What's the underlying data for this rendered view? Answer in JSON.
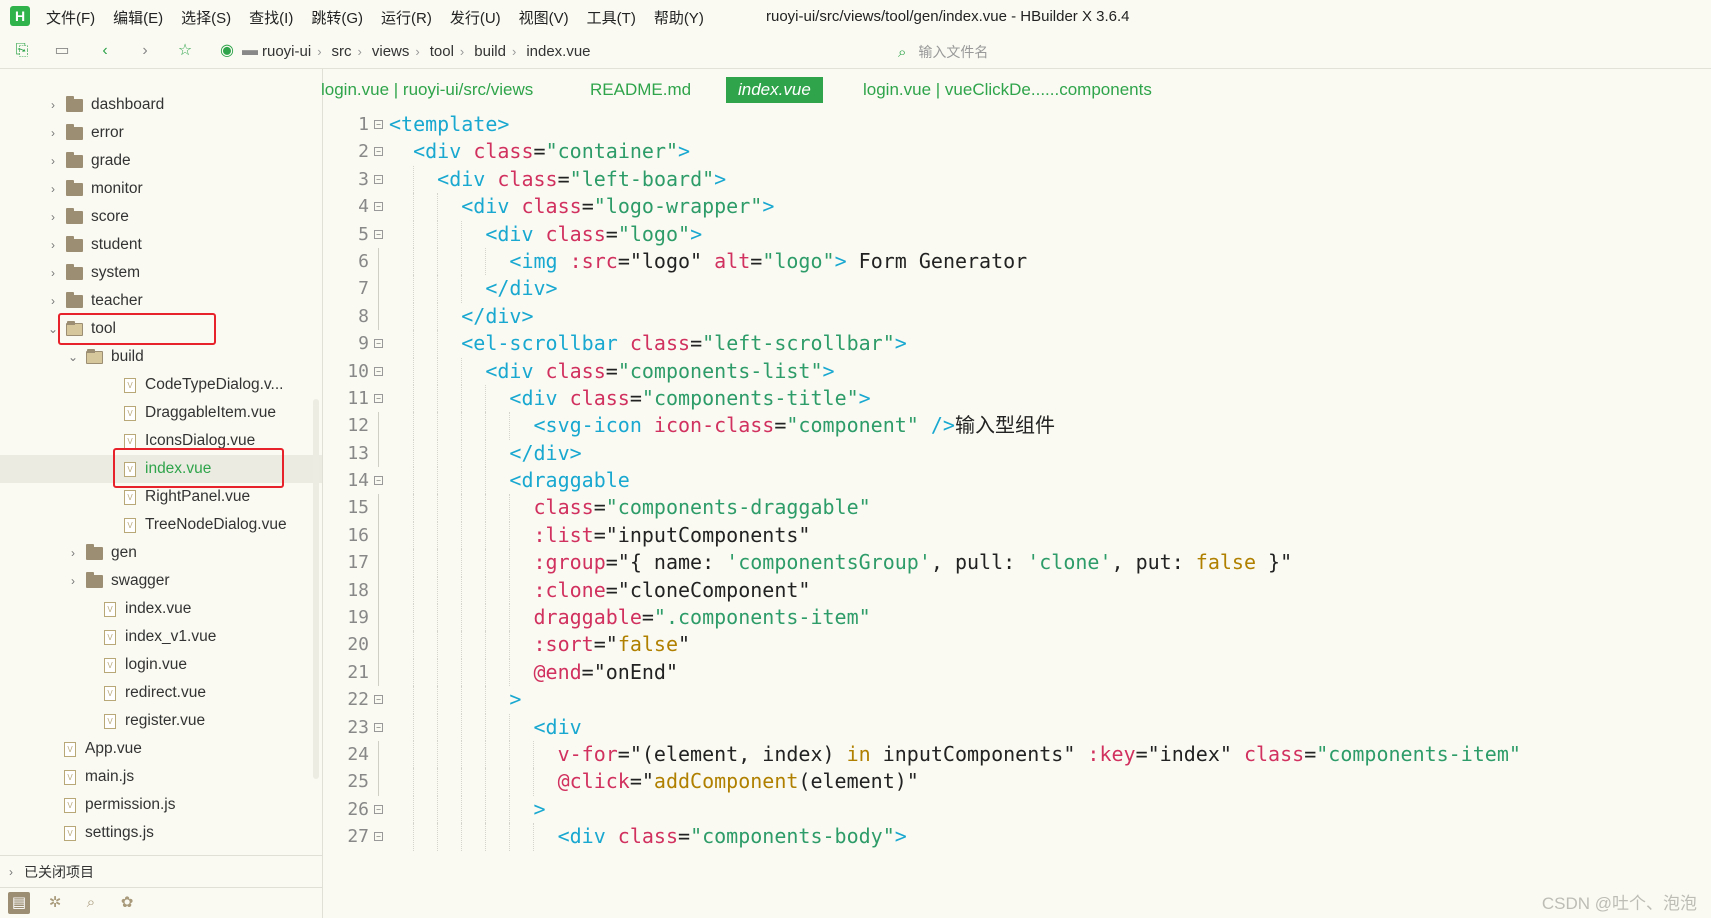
{
  "app": {
    "logo_text": "H",
    "menus": [
      "文件(F)",
      "编辑(E)",
      "选择(S)",
      "查找(I)",
      "跳转(G)",
      "运行(R)",
      "发行(U)",
      "视图(V)",
      "工具(T)",
      "帮助(Y)"
    ],
    "window_title": "ruoyi-ui/src/views/tool/gen/index.vue - HBuilder X 3.6.4"
  },
  "toolbar": {
    "icons": [
      "new-file-icon",
      "save-icon",
      "back-arrow-icon",
      "forward-arrow-icon",
      "star-icon",
      "run-icon"
    ],
    "breadcrumb": [
      "ruoyi-ui",
      "src",
      "views",
      "tool",
      "build",
      "index.vue"
    ],
    "file_search_placeholder": "输入文件名"
  },
  "sidebar": {
    "tree": [
      {
        "label": "dashboard",
        "kind": "folder",
        "depth": 0,
        "state": "collapsed"
      },
      {
        "label": "error",
        "kind": "folder",
        "depth": 0,
        "state": "collapsed"
      },
      {
        "label": "grade",
        "kind": "folder",
        "depth": 0,
        "state": "collapsed"
      },
      {
        "label": "monitor",
        "kind": "folder",
        "depth": 0,
        "state": "collapsed"
      },
      {
        "label": "score",
        "kind": "folder",
        "depth": 0,
        "state": "collapsed"
      },
      {
        "label": "student",
        "kind": "folder",
        "depth": 0,
        "state": "collapsed"
      },
      {
        "label": "system",
        "kind": "folder",
        "depth": 0,
        "state": "collapsed"
      },
      {
        "label": "teacher",
        "kind": "folder",
        "depth": 0,
        "state": "collapsed"
      },
      {
        "label": "tool",
        "kind": "folder",
        "depth": 0,
        "state": "expanded",
        "highlighted": true
      },
      {
        "label": "build",
        "kind": "folder",
        "depth": 1,
        "state": "expanded"
      },
      {
        "label": "CodeTypeDialog.v...",
        "kind": "file",
        "depth": 2
      },
      {
        "label": "DraggableItem.vue",
        "kind": "file",
        "depth": 2
      },
      {
        "label": "IconsDialog.vue",
        "kind": "file",
        "depth": 2
      },
      {
        "label": "index.vue",
        "kind": "file",
        "depth": 2,
        "selected": true,
        "highlighted": true
      },
      {
        "label": "RightPanel.vue",
        "kind": "file",
        "depth": 2
      },
      {
        "label": "TreeNodeDialog.vue",
        "kind": "file",
        "depth": 2
      },
      {
        "label": "gen",
        "kind": "folder",
        "depth": 1,
        "state": "collapsed"
      },
      {
        "label": "swagger",
        "kind": "folder",
        "depth": 1,
        "state": "collapsed"
      },
      {
        "label": "index.vue",
        "kind": "file",
        "depth": 1
      },
      {
        "label": "index_v1.vue",
        "kind": "file",
        "depth": 1
      },
      {
        "label": "login.vue",
        "kind": "file",
        "depth": 1
      },
      {
        "label": "redirect.vue",
        "kind": "file",
        "depth": 1
      },
      {
        "label": "register.vue",
        "kind": "file",
        "depth": 1
      },
      {
        "label": "App.vue",
        "kind": "file",
        "depth": -1
      },
      {
        "label": "main.js",
        "kind": "file",
        "depth": -1
      },
      {
        "label": "permission.js",
        "kind": "file",
        "depth": -1
      },
      {
        "label": "settings.js",
        "kind": "file",
        "depth": -1
      }
    ],
    "closed_projects_label": "已关闭项目",
    "bottom_icons": [
      "project-icon",
      "bug-icon",
      "search-code-icon",
      "plugin-icon"
    ]
  },
  "tabs": [
    {
      "label": "login.vue | ruoyi-ui/src/views",
      "active": false
    },
    {
      "label": "README.md",
      "active": false
    },
    {
      "label": "index.vue",
      "active": true
    },
    {
      "label": "login.vue | vueClickDe......components",
      "active": false
    }
  ],
  "code": {
    "line_numbers": [
      "1",
      "2",
      "3",
      "4",
      "5",
      "6",
      "7",
      "8",
      "9",
      "10",
      "11",
      "12",
      "13",
      "14",
      "15",
      "16",
      "17",
      "18",
      "19",
      "20",
      "21",
      "22",
      "23",
      "24",
      "25",
      "26",
      "27"
    ],
    "folds": [
      true,
      true,
      true,
      true,
      true,
      false,
      false,
      false,
      true,
      true,
      true,
      false,
      false,
      true,
      false,
      false,
      false,
      false,
      false,
      false,
      false,
      true,
      true,
      false,
      false,
      true,
      true
    ],
    "lines": [
      [
        [
          "t",
          "<template>"
        ]
      ],
      [
        [
          "p",
          "  "
        ],
        [
          "t",
          "<div"
        ],
        [
          "p",
          " "
        ],
        [
          "a",
          "class"
        ],
        [
          "p",
          "="
        ],
        [
          "s",
          "\"container\""
        ],
        [
          "t",
          ">"
        ]
      ],
      [
        [
          "p",
          "    "
        ],
        [
          "t",
          "<div"
        ],
        [
          "p",
          " "
        ],
        [
          "a",
          "class"
        ],
        [
          "p",
          "="
        ],
        [
          "s",
          "\"left-board\""
        ],
        [
          "t",
          ">"
        ]
      ],
      [
        [
          "p",
          "      "
        ],
        [
          "t",
          "<div"
        ],
        [
          "p",
          " "
        ],
        [
          "a",
          "class"
        ],
        [
          "p",
          "="
        ],
        [
          "s",
          "\"logo-wrapper\""
        ],
        [
          "t",
          ">"
        ]
      ],
      [
        [
          "p",
          "        "
        ],
        [
          "t",
          "<div"
        ],
        [
          "p",
          " "
        ],
        [
          "a",
          "class"
        ],
        [
          "p",
          "="
        ],
        [
          "s",
          "\"logo\""
        ],
        [
          "t",
          ">"
        ]
      ],
      [
        [
          "p",
          "          "
        ],
        [
          "t",
          "<img"
        ],
        [
          "p",
          " "
        ],
        [
          "a",
          ":src"
        ],
        [
          "p",
          "=\"logo\" "
        ],
        [
          "a",
          "alt"
        ],
        [
          "p",
          "="
        ],
        [
          "s",
          "\"logo\""
        ],
        [
          "t",
          ">"
        ],
        [
          "p",
          " Form Generator"
        ]
      ],
      [
        [
          "p",
          "        "
        ],
        [
          "t",
          "</div>"
        ]
      ],
      [
        [
          "p",
          "      "
        ],
        [
          "t",
          "</div>"
        ]
      ],
      [
        [
          "p",
          "      "
        ],
        [
          "t",
          "<el-scrollbar"
        ],
        [
          "p",
          " "
        ],
        [
          "a",
          "class"
        ],
        [
          "p",
          "="
        ],
        [
          "s",
          "\"left-scrollbar\""
        ],
        [
          "t",
          ">"
        ]
      ],
      [
        [
          "p",
          "        "
        ],
        [
          "t",
          "<div"
        ],
        [
          "p",
          " "
        ],
        [
          "a",
          "class"
        ],
        [
          "p",
          "="
        ],
        [
          "s",
          "\"components-list\""
        ],
        [
          "t",
          ">"
        ]
      ],
      [
        [
          "p",
          "          "
        ],
        [
          "t",
          "<div"
        ],
        [
          "p",
          " "
        ],
        [
          "a",
          "class"
        ],
        [
          "p",
          "="
        ],
        [
          "s",
          "\"components-title\""
        ],
        [
          "t",
          ">"
        ]
      ],
      [
        [
          "p",
          "            "
        ],
        [
          "t",
          "<svg-icon"
        ],
        [
          "p",
          " "
        ],
        [
          "a",
          "icon-class"
        ],
        [
          "p",
          "="
        ],
        [
          "s",
          "\"component\""
        ],
        [
          "p",
          " "
        ],
        [
          "t",
          "/>"
        ],
        [
          "cn",
          "输入型组件"
        ]
      ],
      [
        [
          "p",
          "          "
        ],
        [
          "t",
          "</div>"
        ]
      ],
      [
        [
          "p",
          "          "
        ],
        [
          "t",
          "<draggable"
        ]
      ],
      [
        [
          "p",
          "            "
        ],
        [
          "a",
          "class"
        ],
        [
          "p",
          "="
        ],
        [
          "s",
          "\"components-draggable\""
        ]
      ],
      [
        [
          "p",
          "            "
        ],
        [
          "a",
          ":list"
        ],
        [
          "p",
          "=\"inputComponents\""
        ]
      ],
      [
        [
          "p",
          "            "
        ],
        [
          "a",
          ":group"
        ],
        [
          "p",
          "=\"{ name: "
        ],
        [
          "s",
          "'componentsGroup'"
        ],
        [
          "p",
          ", pull: "
        ],
        [
          "s",
          "'clone'"
        ],
        [
          "p",
          ", put: "
        ],
        [
          "k",
          "false"
        ],
        [
          "p",
          " }\""
        ]
      ],
      [
        [
          "p",
          "            "
        ],
        [
          "a",
          ":clone"
        ],
        [
          "p",
          "=\"cloneComponent\""
        ]
      ],
      [
        [
          "p",
          "            "
        ],
        [
          "a",
          "draggable"
        ],
        [
          "p",
          "="
        ],
        [
          "s",
          "\".components-item\""
        ]
      ],
      [
        [
          "p",
          "            "
        ],
        [
          "a",
          ":sort"
        ],
        [
          "p",
          "=\""
        ],
        [
          "k",
          "false"
        ],
        [
          "p",
          "\""
        ]
      ],
      [
        [
          "p",
          "            "
        ],
        [
          "a",
          "@end"
        ],
        [
          "p",
          "=\"onEnd\""
        ]
      ],
      [
        [
          "p",
          "          "
        ],
        [
          "t",
          ">"
        ]
      ],
      [
        [
          "p",
          "            "
        ],
        [
          "t",
          "<div"
        ]
      ],
      [
        [
          "p",
          "              "
        ],
        [
          "a",
          "v-for"
        ],
        [
          "p",
          "=\"(element, index) "
        ],
        [
          "k",
          "in"
        ],
        [
          "p",
          " inputComponents\" "
        ],
        [
          "a",
          ":key"
        ],
        [
          "p",
          "=\"index\" "
        ],
        [
          "a",
          "class"
        ],
        [
          "p",
          "="
        ],
        [
          "s",
          "\"components-item\""
        ]
      ],
      [
        [
          "p",
          "              "
        ],
        [
          "a",
          "@click"
        ],
        [
          "p",
          "=\""
        ],
        [
          "k",
          "addComponent"
        ],
        [
          "p",
          "(element)\""
        ]
      ],
      [
        [
          "p",
          "            "
        ],
        [
          "t",
          ">"
        ]
      ],
      [
        [
          "p",
          "              "
        ],
        [
          "t",
          "<div"
        ],
        [
          "p",
          " "
        ],
        [
          "a",
          "class"
        ],
        [
          "p",
          "="
        ],
        [
          "s",
          "\"components-body\""
        ],
        [
          "t",
          ">"
        ]
      ]
    ]
  },
  "watermark": "CSDN @吐个、泡泡"
}
